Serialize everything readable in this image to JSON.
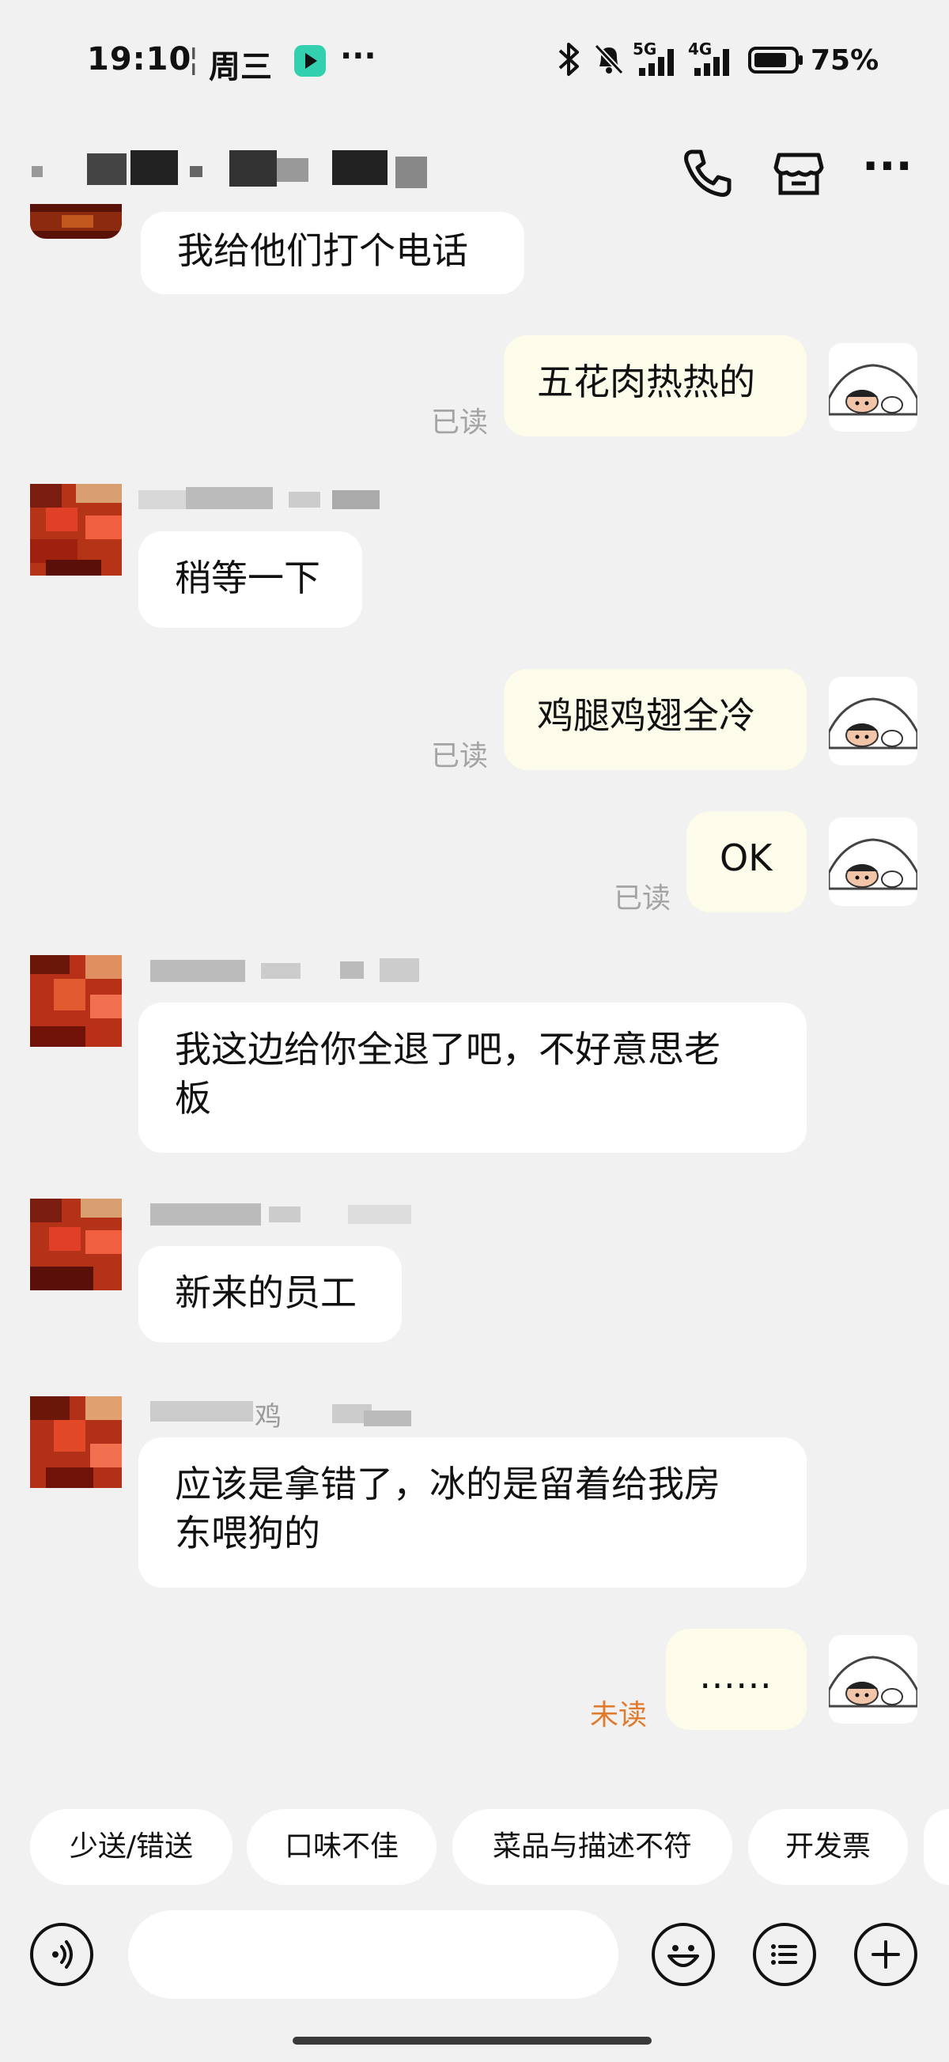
{
  "status_bar": {
    "time": "19:10",
    "separator": "¦",
    "day": "周三",
    "more": "···",
    "net1": "5G",
    "net2": "4G",
    "battery": "75%"
  },
  "header": {
    "icons": [
      "phone-icon",
      "shop-icon",
      "more-icon"
    ],
    "more_label": "···"
  },
  "messages": [
    {
      "side": "in",
      "text": "我给他们打个电话"
    },
    {
      "side": "out",
      "text": "五花肉热热的",
      "status": "已读"
    },
    {
      "side": "in",
      "text": "稍等一下"
    },
    {
      "side": "out",
      "text": "鸡腿鸡翅全冷",
      "status": "已读"
    },
    {
      "side": "out",
      "text": "OK",
      "status": "已读"
    },
    {
      "side": "in",
      "text_line1": "我这边给你全退了吧，不好意思老",
      "text_line2": "板"
    },
    {
      "side": "in",
      "text": "新来的员工"
    },
    {
      "side": "in",
      "sender_fragment": "鸡",
      "text_line1": "应该是拿错了，冰的是留着给我房",
      "text_line2": "东喂狗的"
    },
    {
      "side": "out",
      "text": "……",
      "status": "未读"
    }
  ],
  "quick_replies": [
    "少送/错送",
    "口味不佳",
    "菜品与描述不符",
    "开发票"
  ],
  "input_bar": {
    "voice_icon": "voice-icon",
    "emoji_icon": "emoji-icon",
    "list_icon": "list-icon",
    "plus_icon": "plus-icon",
    "value": ""
  },
  "colors": {
    "background": "#f1f1f1",
    "bubble_in": "#ffffff",
    "bubble_out": "#fdfbe9",
    "read": "#a4a4a4",
    "unread": "#e07a2d"
  }
}
